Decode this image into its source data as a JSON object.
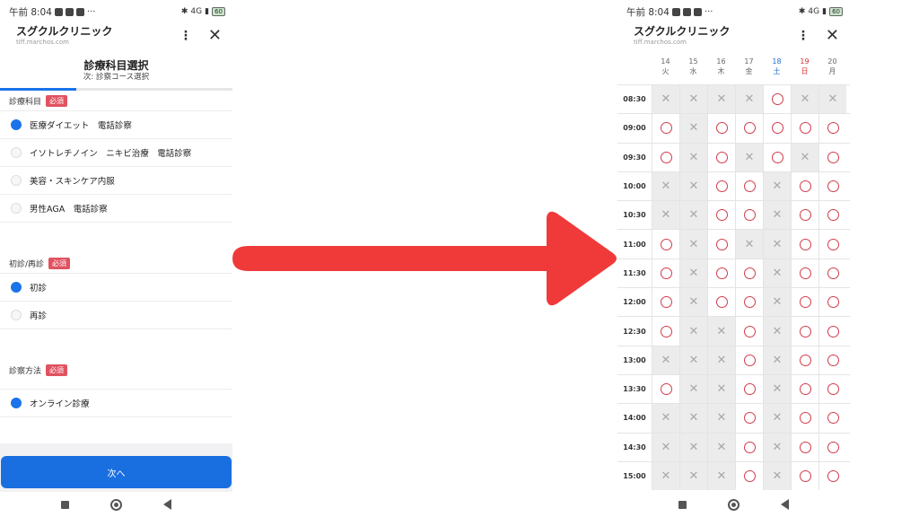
{
  "status_bar": {
    "time": "午前 8:04",
    "right_text": "4G",
    "battery": "60"
  },
  "left_screen": {
    "app_title": "スグクルクリニック",
    "app_url": "tiff.marchos.com",
    "step_title": "診療科目選択",
    "step_sub": "次: 診察コース選択",
    "progress": 0.33,
    "sections": [
      {
        "label": "診療科目",
        "required": "必須",
        "options": [
          {
            "label": "医療ダイエット　電話診察",
            "selected": true
          },
          {
            "label": "イソトレチノイン　ニキビ治療　電話診察",
            "selected": false
          },
          {
            "label": "美容・スキンケア内服",
            "selected": false
          },
          {
            "label": "男性AGA　電話診察",
            "selected": false
          }
        ]
      },
      {
        "label": "初診/再診",
        "required": "必須",
        "options": [
          {
            "label": "初診",
            "selected": true
          },
          {
            "label": "再診",
            "selected": false
          }
        ]
      },
      {
        "label": "診察方法",
        "required": "必須",
        "options": [
          {
            "label": "オンライン診療",
            "selected": true
          }
        ]
      }
    ],
    "next_button": "次へ"
  },
  "right_screen": {
    "app_title": "スグクルクリニック",
    "app_url": "tiff.marchos.com",
    "days": [
      {
        "date": "14",
        "weekday": "火",
        "kind": "weekday"
      },
      {
        "date": "15",
        "weekday": "水",
        "kind": "weekday"
      },
      {
        "date": "16",
        "weekday": "木",
        "kind": "weekday"
      },
      {
        "date": "17",
        "weekday": "金",
        "kind": "weekday"
      },
      {
        "date": "18",
        "weekday": "土",
        "kind": "sat"
      },
      {
        "date": "19",
        "weekday": "日",
        "kind": "sun"
      },
      {
        "date": "20",
        "weekday": "月",
        "kind": "weekday"
      }
    ],
    "rows": [
      {
        "time": "08:30",
        "slots": [
          "x",
          "x",
          "x",
          "x",
          "o",
          "x",
          "x"
        ]
      },
      {
        "time": "09:00",
        "slots": [
          "o",
          "x",
          "o",
          "o",
          "o",
          "o",
          "o"
        ]
      },
      {
        "time": "09:30",
        "slots": [
          "o",
          "x",
          "o",
          "x",
          "o",
          "x",
          "o"
        ]
      },
      {
        "time": "10:00",
        "slots": [
          "x",
          "x",
          "o",
          "o",
          "x",
          "o",
          "o"
        ]
      },
      {
        "time": "10:30",
        "slots": [
          "x",
          "x",
          "o",
          "o",
          "x",
          "o",
          "o"
        ]
      },
      {
        "time": "11:00",
        "slots": [
          "o",
          "x",
          "o",
          "x",
          "x",
          "o",
          "o"
        ]
      },
      {
        "time": "11:30",
        "slots": [
          "o",
          "x",
          "o",
          "o",
          "x",
          "o",
          "o"
        ]
      },
      {
        "time": "12:00",
        "slots": [
          "o",
          "x",
          "o",
          "o",
          "x",
          "o",
          "o"
        ]
      },
      {
        "time": "12:30",
        "slots": [
          "o",
          "x",
          "x",
          "o",
          "x",
          "o",
          "o"
        ]
      },
      {
        "time": "13:00",
        "slots": [
          "x",
          "x",
          "x",
          "o",
          "x",
          "o",
          "o"
        ]
      },
      {
        "time": "13:30",
        "slots": [
          "o",
          "x",
          "x",
          "o",
          "x",
          "o",
          "o"
        ]
      },
      {
        "time": "14:00",
        "slots": [
          "x",
          "x",
          "x",
          "o",
          "x",
          "o",
          "o"
        ]
      },
      {
        "time": "14:30",
        "slots": [
          "x",
          "x",
          "x",
          "o",
          "x",
          "o",
          "o"
        ]
      },
      {
        "time": "15:00",
        "slots": [
          "x",
          "x",
          "x",
          "o",
          "x",
          "o",
          "o"
        ]
      }
    ]
  },
  "colors": {
    "primary": "#1a73e8",
    "required_badge": "#e05260",
    "available_mark": "#d23c4a",
    "arrow": "#f03a3a"
  }
}
